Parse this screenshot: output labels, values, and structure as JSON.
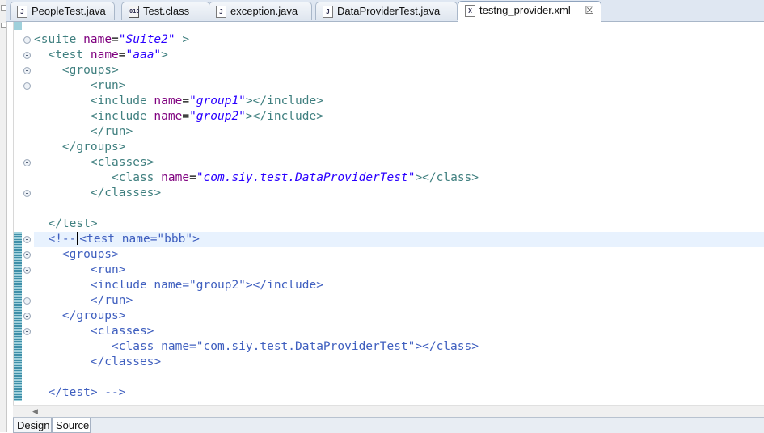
{
  "tabs": [
    {
      "label": "PeopleTest.java",
      "icon": "java-file-icon",
      "active": false
    },
    {
      "label": "Test.class",
      "icon": "class-file-icon",
      "active": false
    },
    {
      "label": "exception.java",
      "icon": "java-file-icon",
      "active": false
    },
    {
      "label": "DataProviderTest.java",
      "icon": "java-file-icon",
      "active": false
    },
    {
      "label": "testng_provider.xml",
      "icon": "xml-file-icon",
      "active": true,
      "close": "☒"
    }
  ],
  "code": {
    "suite_name": "\"Suite2\"",
    "test1_name": "\"aaa\"",
    "group1": "\"group1\"",
    "group2": "\"group2\"",
    "class1": "\"com.siy.test.DataProviderTest\"",
    "comment_open": "<!--",
    "test2_tag": "<test name=\"bbb\">",
    "c_groups_open": "<groups>",
    "c_run_open": "<run>",
    "c_include": "<include name=\"group2\"></include>",
    "c_run_close": "</run>",
    "c_groups_close": "</groups>",
    "c_classes_open": "<classes>",
    "c_class": "<class name=\"com.siy.test.DataProviderTest\"></class>",
    "c_classes_close": "</classes>",
    "c_test_close": "</test> -->"
  },
  "bottom_tabs": [
    {
      "label": "Design",
      "active": false
    },
    {
      "label": "Source",
      "active": true
    }
  ],
  "colors": {
    "tag": "#3f7f7f",
    "attribute": "#7f007f",
    "value": "#2a00ff",
    "comment": "#3f5fbf"
  }
}
